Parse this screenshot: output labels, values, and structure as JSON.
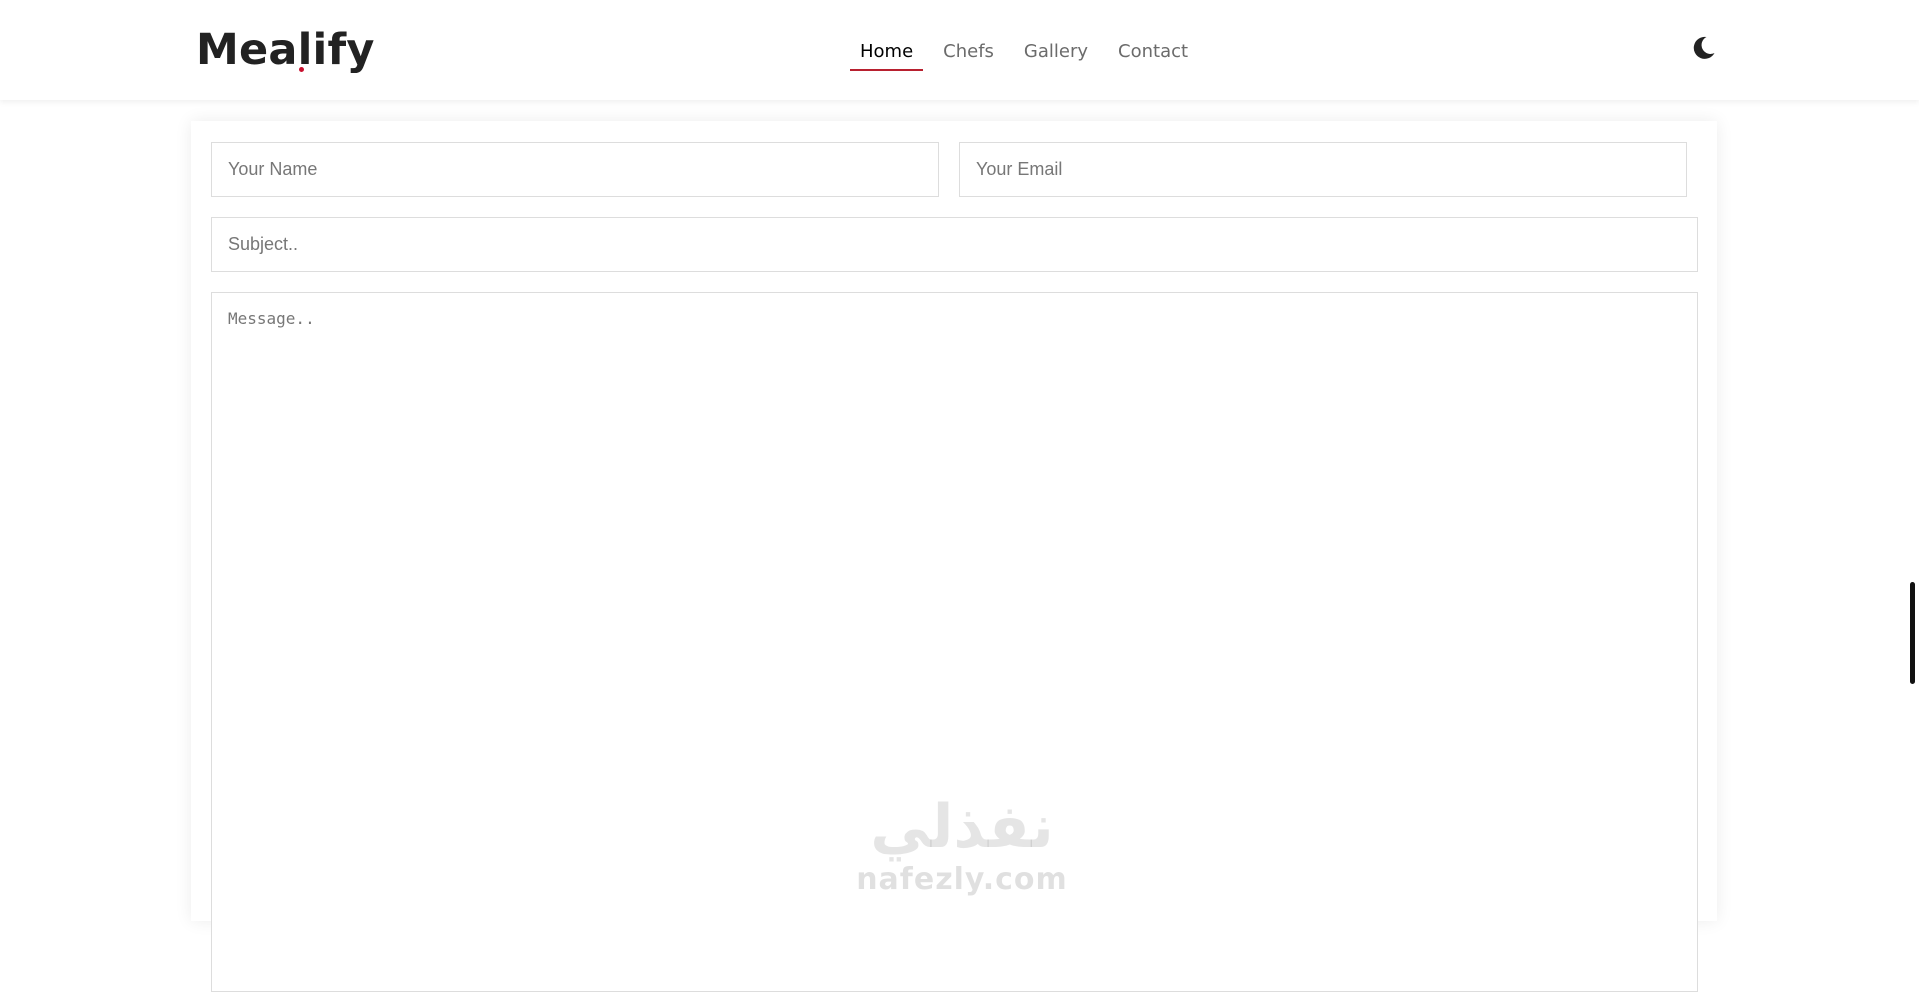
{
  "header": {
    "logo": "Mealify",
    "nav": [
      {
        "label": "Home",
        "active": true
      },
      {
        "label": "Chefs",
        "active": false
      },
      {
        "label": "Gallery",
        "active": false
      },
      {
        "label": "Contact",
        "active": false
      }
    ],
    "theme_toggle_icon": "moon-icon"
  },
  "contact_form": {
    "name": {
      "placeholder": "Your Name",
      "value": ""
    },
    "email": {
      "placeholder": "Your Email",
      "value": ""
    },
    "subject": {
      "placeholder": "Subject..",
      "value": ""
    },
    "message": {
      "placeholder": "Message..",
      "value": ""
    }
  },
  "watermark": {
    "arabic": "نفذلي",
    "latin": "nafezly.com"
  },
  "colors": {
    "accent": "#b8202f",
    "text_dark": "#222222",
    "nav_inactive": "#6b6b6b",
    "field_border": "#dddddd"
  }
}
